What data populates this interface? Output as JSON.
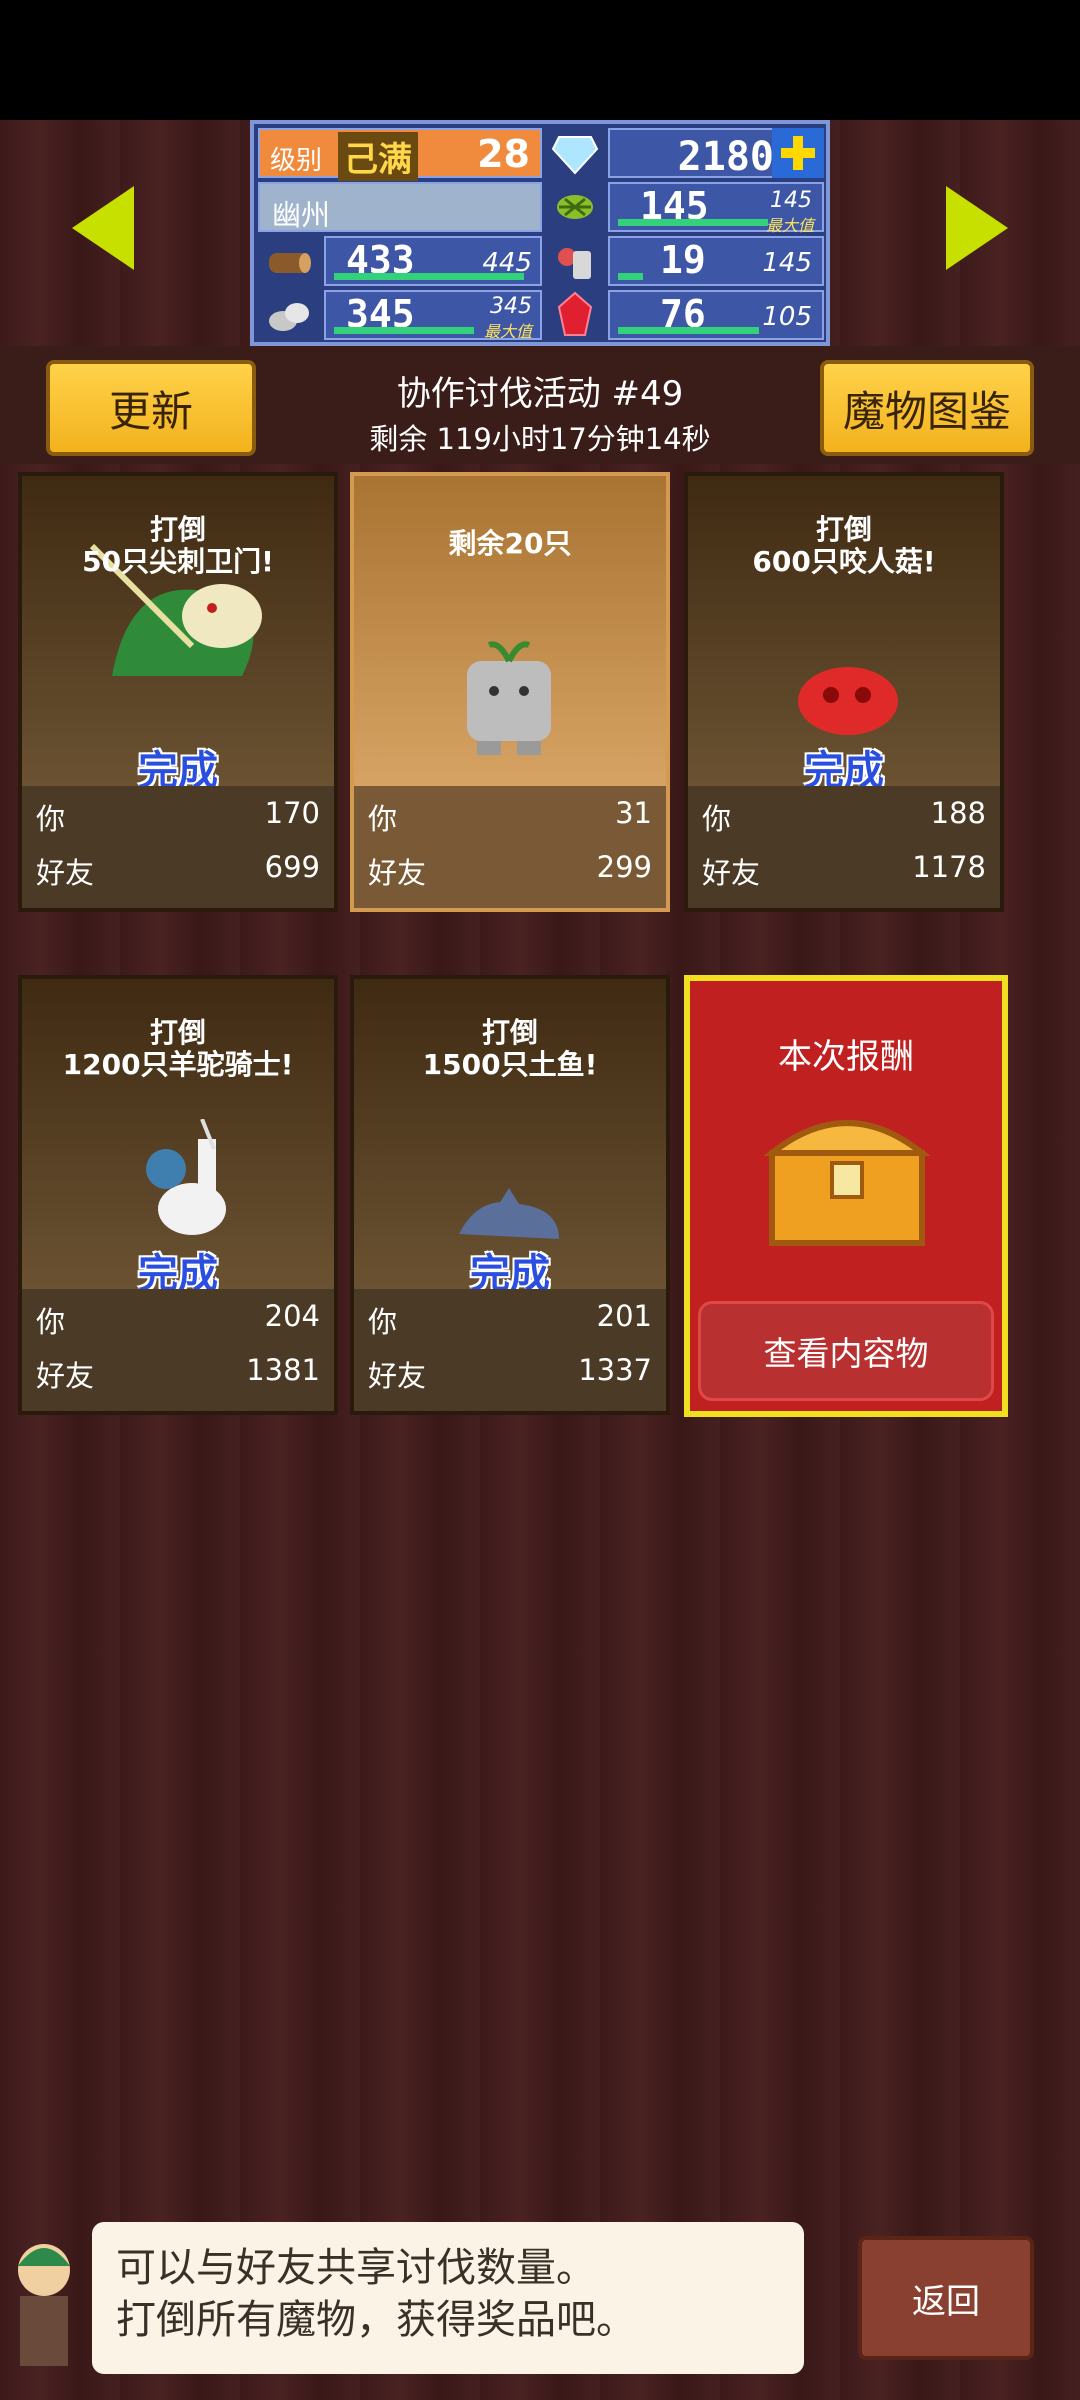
{
  "resources": {
    "level_label": "级别",
    "level_badge": "己满",
    "level_value": "28",
    "gems": "2180",
    "location": "幽州",
    "food_value": "145",
    "food_max": "145",
    "food_max_note": "最大值",
    "wood_value": "433",
    "wood_max": "445",
    "troops_value": "19",
    "troops_max": "145",
    "stone_value": "345",
    "stone_max": "345",
    "stone_max_note": "最大值",
    "ruby_value": "76",
    "ruby_max": "105",
    "wood_fill": 0.97,
    "stone_fill": 1.0,
    "food_fill": 1.0,
    "troops_fill": 0.13,
    "ruby_fill": 0.72
  },
  "header": {
    "update_label": "更新",
    "title": "协作讨伐活动 #49",
    "time_left": "剩余 119小时17分钟14秒",
    "bestiary_label": "魔物图鉴"
  },
  "cards": [
    {
      "mission": "打倒\n50只尖刺卫门!",
      "done": "完成",
      "you_label": "你",
      "you": "170",
      "friend_label": "好友",
      "friend": "699"
    },
    {
      "mission": "剩余20只",
      "done": "",
      "you_label": "你",
      "you": "31",
      "friend_label": "好友",
      "friend": "299"
    },
    {
      "mission": "打倒\n600只咬人菇!",
      "done": "完成",
      "you_label": "你",
      "you": "188",
      "friend_label": "好友",
      "friend": "1178"
    },
    {
      "mission": "打倒\n1200只羊驼骑士!",
      "done": "完成",
      "you_label": "你",
      "you": "204",
      "friend_label": "好友",
      "friend": "1381"
    },
    {
      "mission": "打倒\n1500只土鱼!",
      "done": "完成",
      "you_label": "你",
      "you": "201",
      "friend_label": "好友",
      "friend": "1337"
    }
  ],
  "reward": {
    "title": "本次报酬",
    "view_label": "查看内容物"
  },
  "footer": {
    "hint_line1": "可以与好友共享讨伐数量。",
    "hint_line2": "打倒所有魔物，获得奖品吧。",
    "back_label": "返回"
  },
  "colors": {
    "accent_yellow": "#f3b21d",
    "done_blue": "#2a4fe0",
    "reward_red": "#c02020",
    "panel_blue": "#2b3f80"
  },
  "icons": [
    "diamond-icon",
    "plus-icon",
    "wheat-icon",
    "wood-icon",
    "troops-icon",
    "stone-icon",
    "ruby-icon",
    "treasure-chest-icon"
  ]
}
